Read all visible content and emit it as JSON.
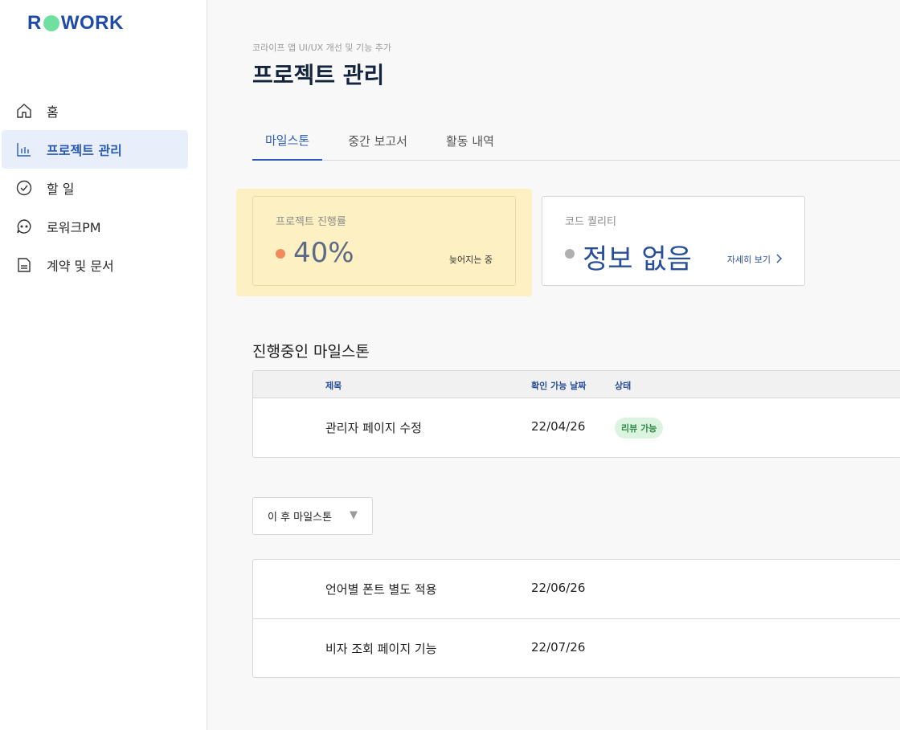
{
  "brand": {
    "logo_left": "R",
    "logo_right": "WORK",
    "accent": "#1f4aa8",
    "dot_color": "#6fe0a0"
  },
  "sidebar": {
    "items": [
      {
        "label": "홈",
        "icon": "home-icon",
        "active": false
      },
      {
        "label": "프로젝트 관리",
        "icon": "bar-chart-icon",
        "active": true
      },
      {
        "label": "할 일",
        "icon": "check-circle-icon",
        "active": false
      },
      {
        "label": "로워크PM",
        "icon": "chat-bubble-icon",
        "active": false
      },
      {
        "label": "계약 및 문서",
        "icon": "document-icon",
        "active": false
      }
    ]
  },
  "header": {
    "breadcrumb": "코라이프 앱 UI/UX 개선 및 기능 추가",
    "title": "프로젝트 관리"
  },
  "tabs": [
    {
      "label": "마일스톤",
      "active": true
    },
    {
      "label": "중간 보고서",
      "active": false
    },
    {
      "label": "활동 내역",
      "active": false
    }
  ],
  "cards": {
    "progress": {
      "label": "프로젝트 진행률",
      "value": "40%",
      "note": "늦어지는 중",
      "dot_color": "#f28b5c"
    },
    "quality": {
      "label": "코드 퀄리티",
      "value": "정보 없음",
      "link": "자세히 보기",
      "dot_color": "#b0b0b0"
    }
  },
  "current_milestones": {
    "title": "진행중인 마일스톤",
    "columns": {
      "title": "제목",
      "date": "확인 가능 날짜",
      "status": "상태"
    },
    "rows": [
      {
        "title": "관리자 페이지 수정",
        "date": "22/04/26",
        "status": "리뷰 가능"
      }
    ]
  },
  "filter": {
    "selected": "이 후 마일스톤"
  },
  "next_milestones": {
    "rows": [
      {
        "title": "언어별 폰트 별도 적용",
        "date": "22/06/26"
      },
      {
        "title": "비자 조회 페이지 기능",
        "date": "22/07/26"
      }
    ]
  }
}
